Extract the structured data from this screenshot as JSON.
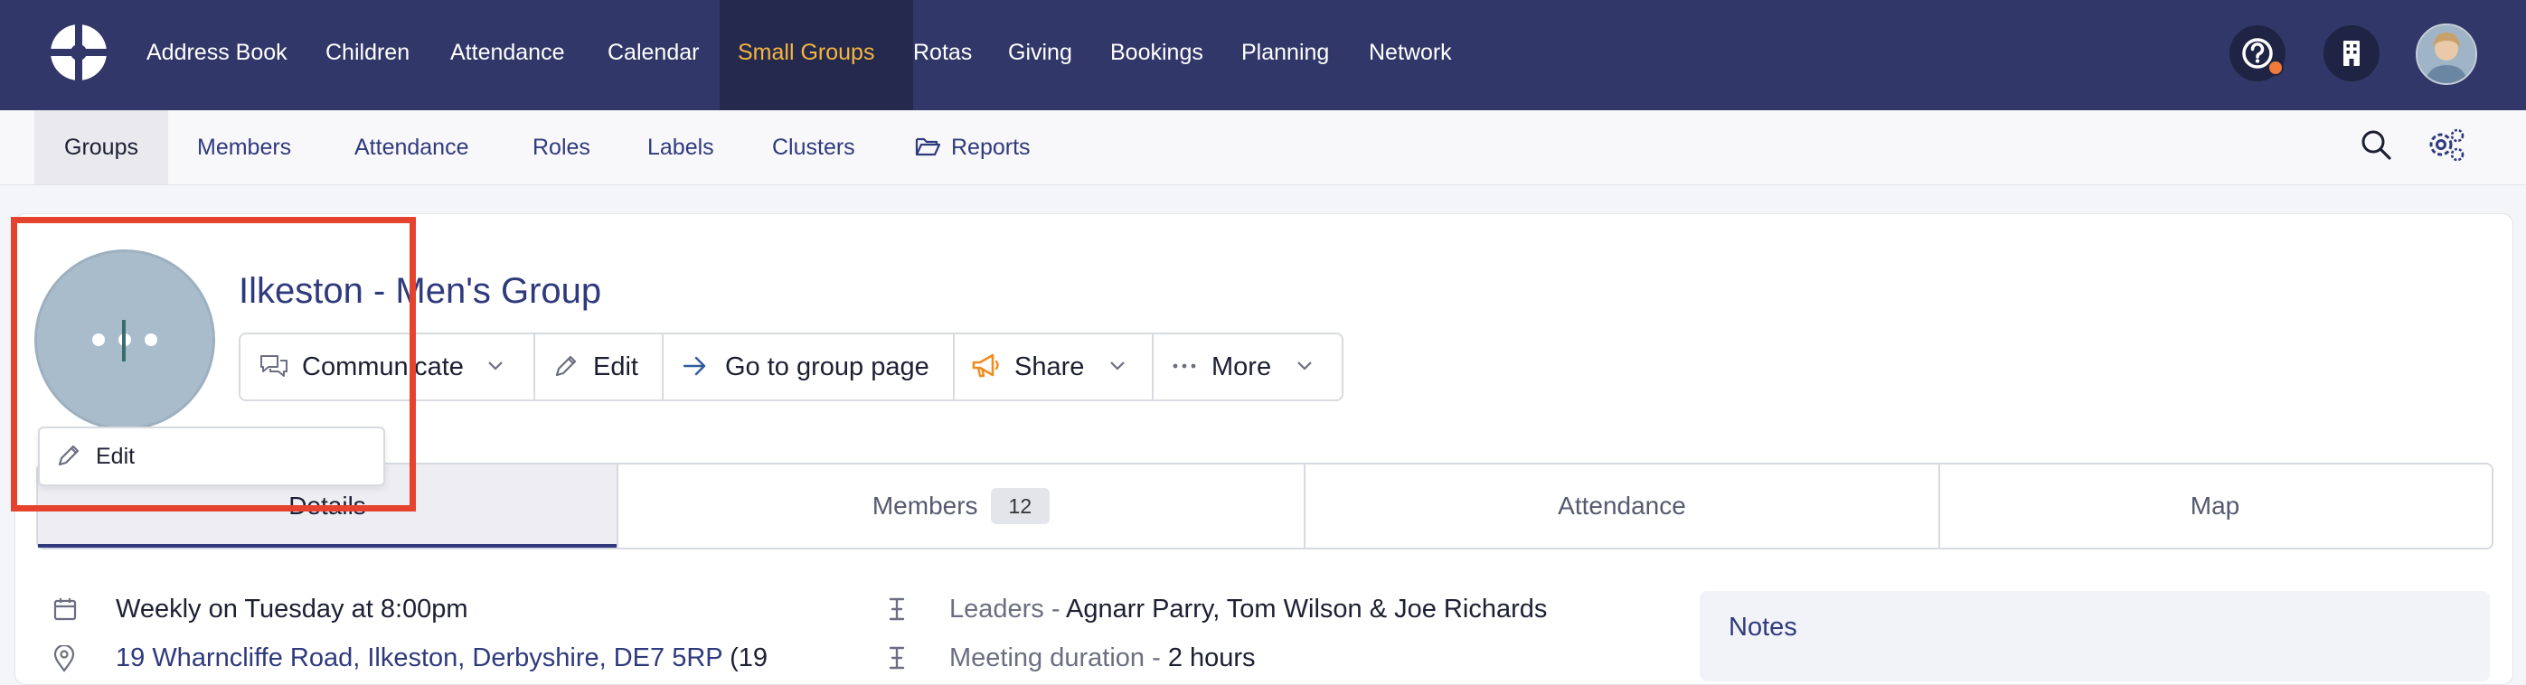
{
  "top_nav": {
    "items": [
      "Address Book",
      "Children",
      "Attendance",
      "Calendar",
      "Small Groups",
      "Rotas",
      "Giving",
      "Bookings",
      "Planning",
      "Network"
    ],
    "active": "Small Groups"
  },
  "sub_nav": {
    "items": [
      "Groups",
      "Members",
      "Attendance",
      "Roles",
      "Labels",
      "Clusters",
      "Reports"
    ],
    "active": "Groups"
  },
  "group": {
    "title": "Ilkeston - Men's Group",
    "avatar_edit_label": "Edit"
  },
  "actions": {
    "communicate": "Communicate",
    "edit": "Edit",
    "go_to_group_page": "Go to group page",
    "share": "Share",
    "more": "More"
  },
  "tabs": {
    "details": "Details",
    "members": "Members",
    "members_count": "12",
    "attendance": "Attendance",
    "map": "Map"
  },
  "details": {
    "schedule": "Weekly on Tuesday at 8:00pm",
    "address": "19 Wharncliffe Road, Ilkeston, Derbyshire, DE7 5RP",
    "address_suffix": "(19",
    "leaders_label": "Leaders - ",
    "leaders": "Agnarr Parry, Tom Wilson & Joe Richards",
    "duration_label": "Meeting duration - ",
    "duration": "2 hours"
  },
  "notes": {
    "title": "Notes"
  },
  "colors": {
    "topbar": "#313768",
    "active_nav_text": "#f4b63f",
    "link": "#2f3a7d",
    "highlight": "#e5432e",
    "share_icon": "#f08c1e"
  }
}
